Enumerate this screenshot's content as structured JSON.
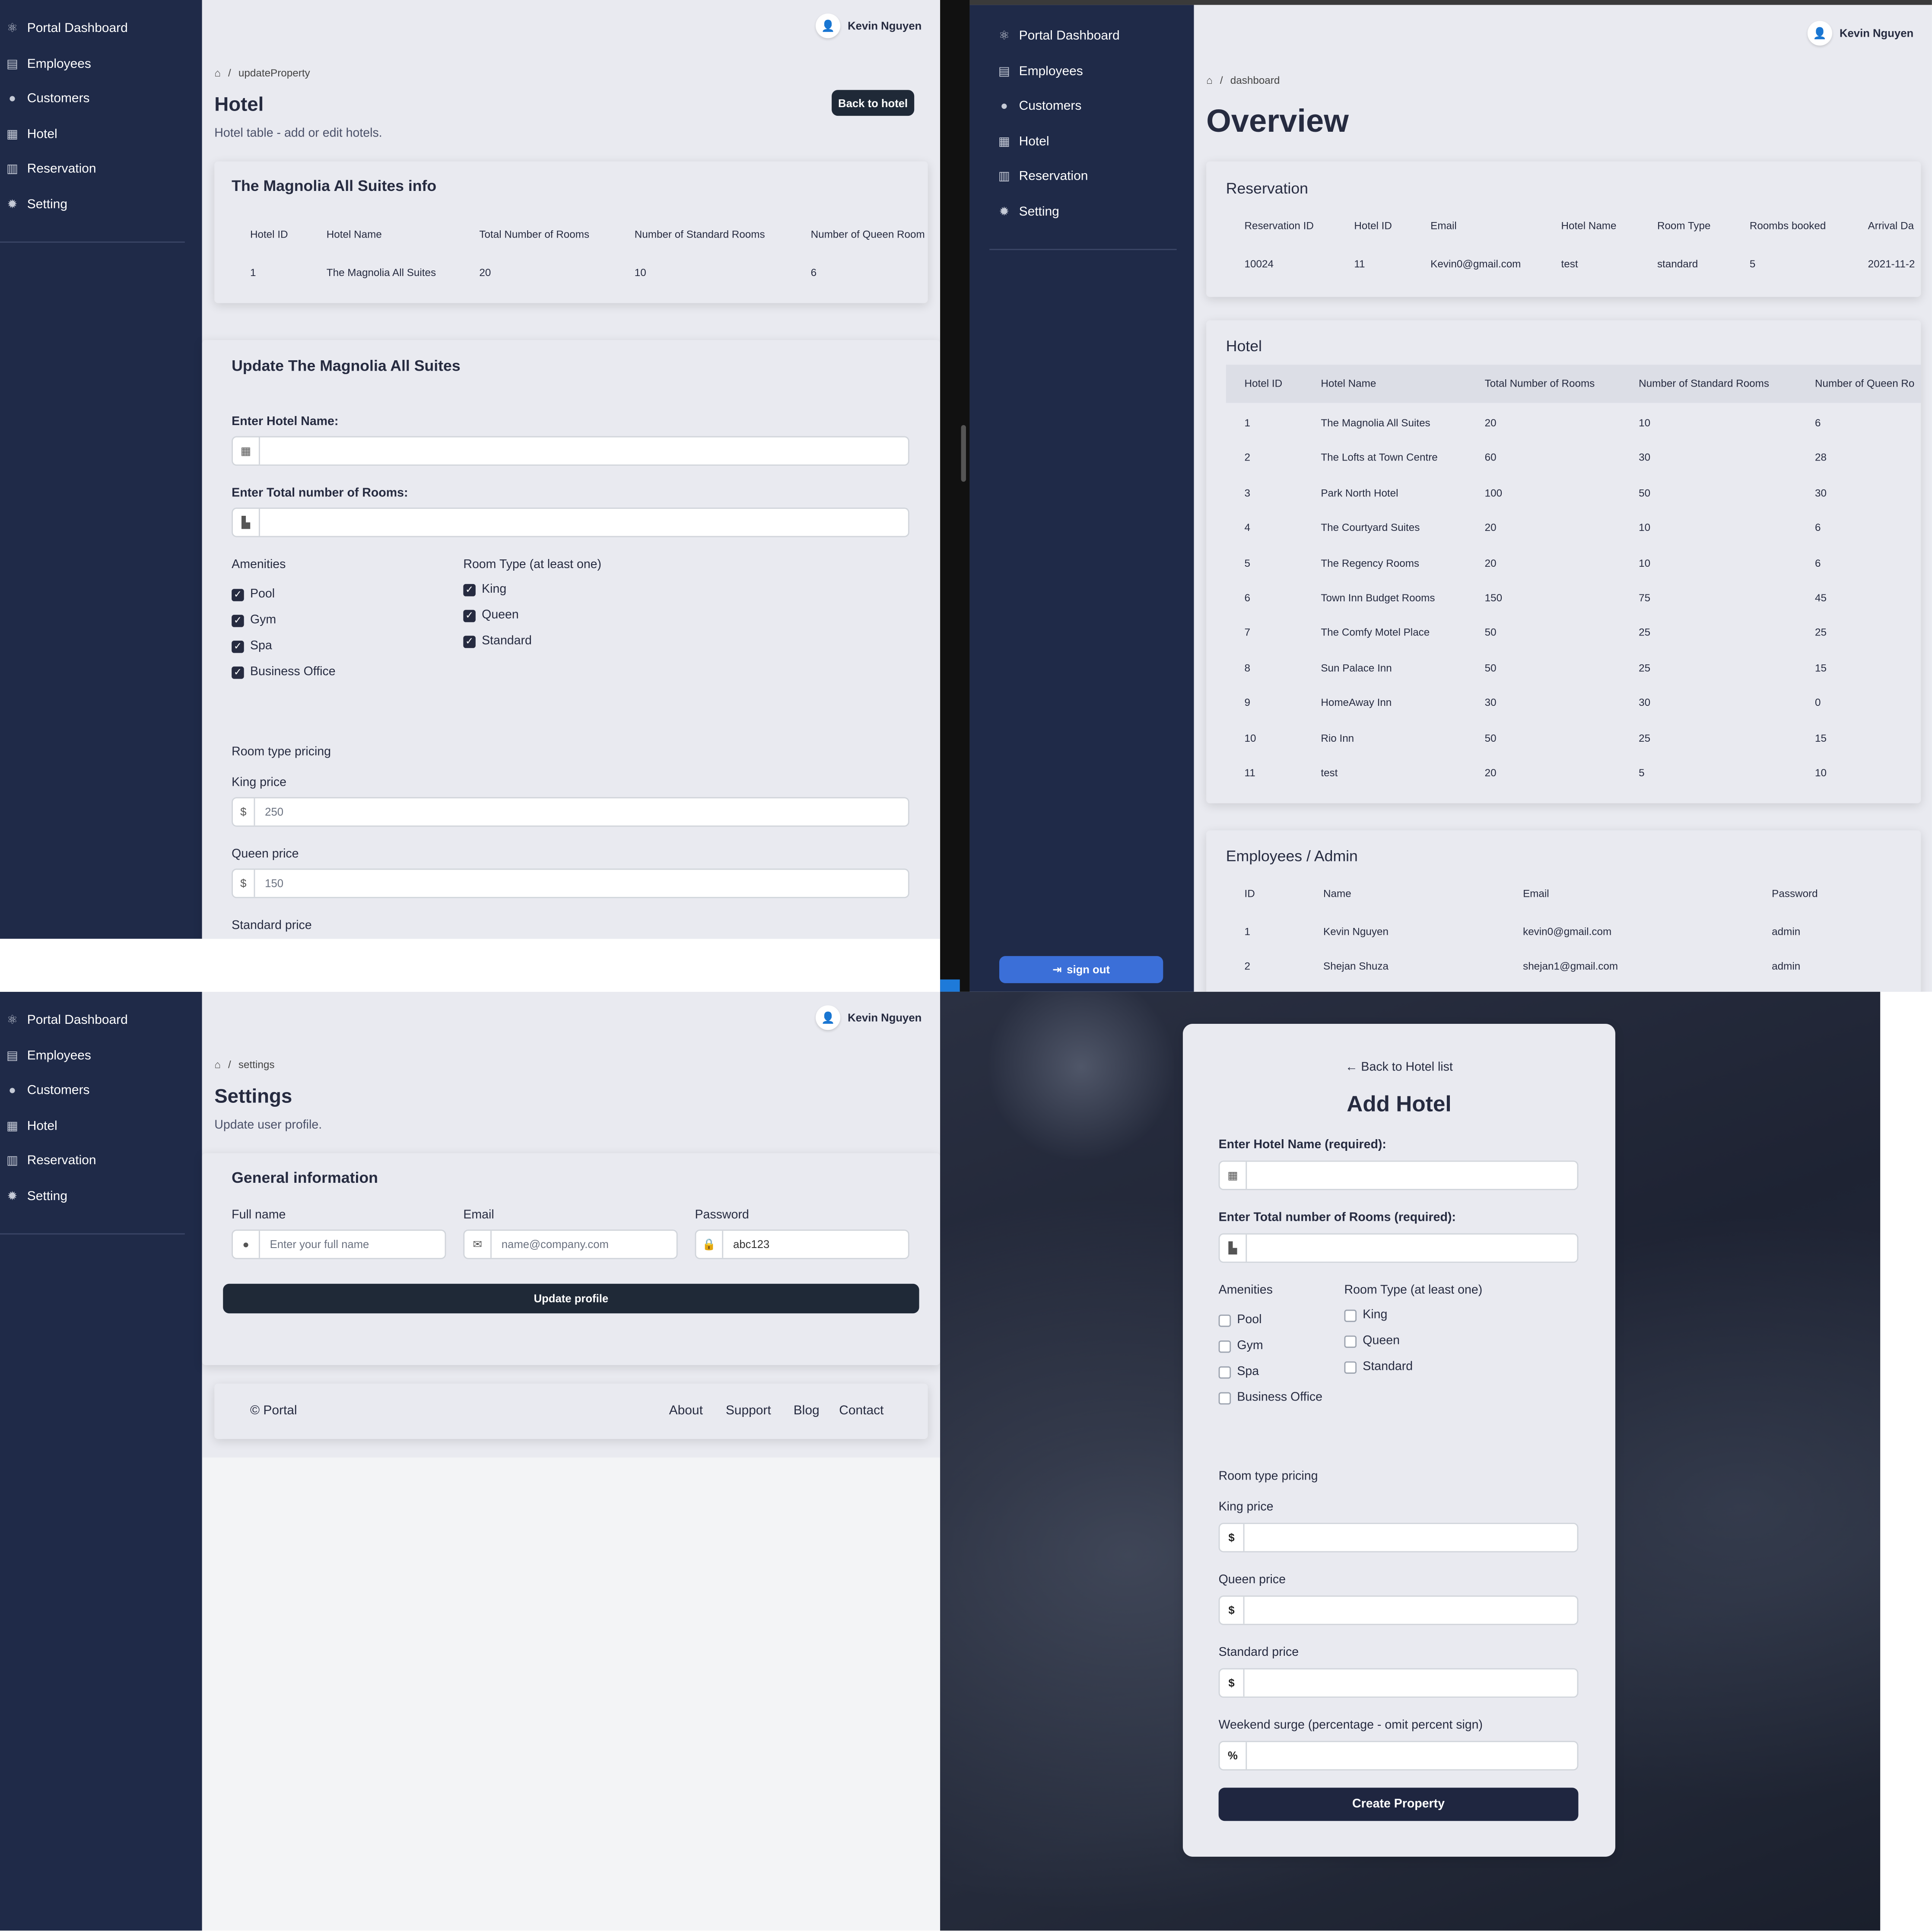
{
  "user": {
    "name": "Kevin Nguyen"
  },
  "sidebar": {
    "brand": "Portal Dashboard",
    "items": [
      {
        "label": "Employees",
        "icon": "id-card-icon"
      },
      {
        "label": "Customers",
        "icon": "user-icon"
      },
      {
        "label": "Hotel",
        "icon": "building-icon"
      },
      {
        "label": "Reservation",
        "icon": "calendar-icon"
      },
      {
        "label": "Setting",
        "icon": "gear-icon"
      }
    ],
    "signout": "sign out"
  },
  "update_page": {
    "breadcrumb": "updateProperty",
    "title": "Hotel",
    "subtitle": "Hotel table - add or edit hotels.",
    "back_button": "Back to hotel",
    "info_card": {
      "title": "The Magnolia All Suites info",
      "headers": [
        "Hotel ID",
        "Hotel Name",
        "Total Number of Rooms",
        "Number of Standard Rooms",
        "Number of Queen Room"
      ],
      "row": [
        "1",
        "The Magnolia All Suites",
        "20",
        "10",
        "6"
      ]
    },
    "form": {
      "title": "Update The Magnolia All Suites",
      "hotel_name_label": "Enter Hotel Name:",
      "rooms_label": "Enter Total number of Rooms:",
      "amenities_label": "Amenities",
      "amenities": [
        "Pool",
        "Gym",
        "Spa",
        "Business Office"
      ],
      "room_type_label": "Room Type (at least one)",
      "room_types": [
        "King",
        "Queen",
        "Standard"
      ],
      "pricing_label": "Room type pricing",
      "king_label": "King price",
      "king_value": "250",
      "queen_label": "Queen price",
      "queen_value": "150",
      "standard_label": "Standard price",
      "currency": "$"
    }
  },
  "dashboard": {
    "breadcrumb": "dashboard",
    "title": "Overview",
    "reservation": {
      "title": "Reservation",
      "headers": [
        "Reservation ID",
        "Hotel ID",
        "Email",
        "Hotel Name",
        "Room Type",
        "Roombs booked",
        "Arrival Da"
      ],
      "row": [
        "10024",
        "11",
        "Kevin0@gmail.com",
        "test",
        "standard",
        "5",
        "2021-11-2"
      ]
    },
    "hotel": {
      "title": "Hotel",
      "headers": [
        "Hotel ID",
        "Hotel Name",
        "Total Number of Rooms",
        "Number of Standard Rooms",
        "Number of Queen Ro"
      ],
      "rows": [
        [
          "1",
          "The Magnolia All Suites",
          "20",
          "10",
          "6"
        ],
        [
          "2",
          "The Lofts at Town Centre",
          "60",
          "30",
          "28"
        ],
        [
          "3",
          "Park North Hotel",
          "100",
          "50",
          "30"
        ],
        [
          "4",
          "The Courtyard Suites",
          "20",
          "10",
          "6"
        ],
        [
          "5",
          "The Regency Rooms",
          "20",
          "10",
          "6"
        ],
        [
          "6",
          "Town Inn Budget Rooms",
          "150",
          "75",
          "45"
        ],
        [
          "7",
          "The Comfy Motel Place",
          "50",
          "25",
          "25"
        ],
        [
          "8",
          "Sun Palace Inn",
          "50",
          "25",
          "15"
        ],
        [
          "9",
          "HomeAway Inn",
          "30",
          "30",
          "0"
        ],
        [
          "10",
          "Rio Inn",
          "50",
          "25",
          "15"
        ],
        [
          "11",
          "test",
          "20",
          "5",
          "10"
        ]
      ]
    },
    "employees": {
      "title": "Employees / Admin",
      "headers": [
        "ID",
        "Name",
        "Email",
        "Password"
      ],
      "rows": [
        [
          "1",
          "Kevin Nguyen",
          "kevin0@gmail.com",
          "admin"
        ],
        [
          "2",
          "Shejan Shuza",
          "shejan1@gmail.com",
          "admin"
        ]
      ]
    }
  },
  "settings": {
    "breadcrumb": "settings",
    "title": "Settings",
    "subtitle": "Update user profile.",
    "card_title": "General information",
    "fullname_label": "Full name",
    "fullname_placeholder": "Enter your full name",
    "email_label": "Email",
    "email_placeholder": "name@company.com",
    "password_label": "Password",
    "password_value": "abc123",
    "update_button": "Update profile",
    "footer": {
      "copyright": "© Portal",
      "links": [
        "About",
        "Support",
        "Blog",
        "Contact"
      ]
    }
  },
  "add_hotel": {
    "back_link": "Back to Hotel list",
    "title": "Add Hotel",
    "hotel_name_label": "Enter Hotel Name (required):",
    "rooms_label": "Enter Total number of Rooms (required):",
    "amenities_label": "Amenities",
    "amenities": [
      "Pool",
      "Gym",
      "Spa",
      "Business Office"
    ],
    "room_type_label": "Room Type (at least one)",
    "room_types": [
      "King",
      "Queen",
      "Standard"
    ],
    "pricing_label": "Room type pricing",
    "king_label": "King price",
    "queen_label": "Queen price",
    "standard_label": "Standard price",
    "surge_label": "Weekend surge (percentage - omit percent sign)",
    "currency": "$",
    "percent": "%",
    "create_button": "Create Property"
  },
  "colors": {
    "sidebar": "#1f2a48",
    "panel_bg": "#e9eaf0",
    "primary_dark": "#1f2937",
    "signout_blue": "#3b6fd8"
  }
}
